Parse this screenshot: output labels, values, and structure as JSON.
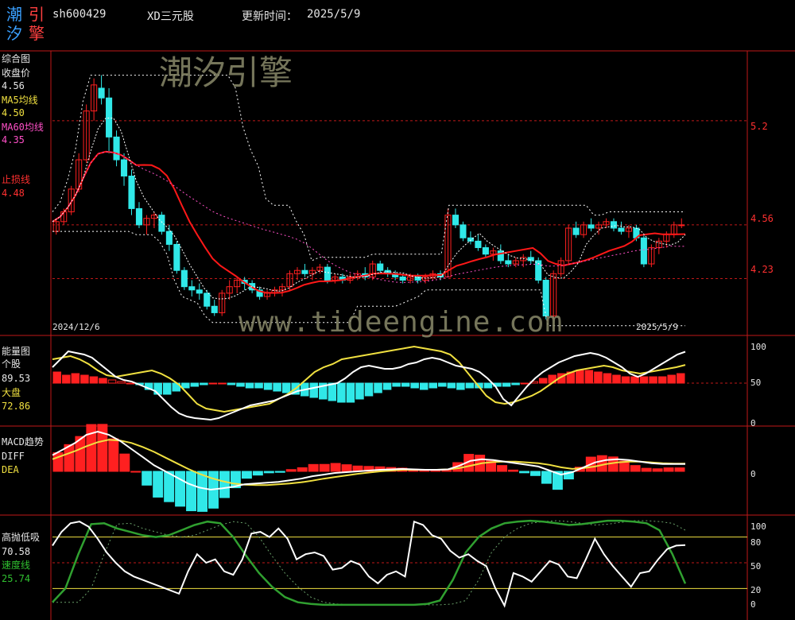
{
  "header": {
    "code": "sh600429",
    "name": "XD三元股",
    "update_label": "更新时间：",
    "update_date": "2025/5/9"
  },
  "logo": {
    "chars": [
      "潮",
      "引",
      "汐",
      "擎"
    ]
  },
  "watermarks": {
    "top": "潮汐引擎",
    "mid": "www.tideengine.com"
  },
  "colors": {
    "up": "#ff2020",
    "down": "#30e8e8",
    "ma5": "#f0e040",
    "ma60": "#ff50c8",
    "stop": "#ff3030",
    "speed": "#30a030"
  },
  "panels": {
    "main": {
      "title": "综合图",
      "close_label": "收盘价",
      "close_value": "4.56",
      "ma5_label": "MA5均线",
      "ma5_value": "4.50",
      "ma60_label": "MA60均线",
      "ma60_value": "4.35",
      "stop_label": "止损线",
      "stop_value": "4.48",
      "date_start": "2024/12/6",
      "date_end": "2025/5/9",
      "axis_labels": [
        "5.2",
        "4.56",
        "4.23"
      ]
    },
    "energy": {
      "title": "能量图",
      "stock_label": "个股",
      "stock_value": "89.53",
      "market_label": "大盘",
      "market_value": "72.86",
      "axis_labels": [
        "100",
        "50",
        "0"
      ]
    },
    "macd": {
      "title": "MACD趋势",
      "diff_label": "DIFF",
      "dea_label": "DEA",
      "axis_labels": [
        "0"
      ]
    },
    "gaopao": {
      "title": "高抛低吸",
      "value": "70.58",
      "speed_label": "速度线",
      "speed_value": "25.74",
      "axis_labels": [
        "100",
        "80",
        "50",
        "20",
        "0"
      ]
    }
  },
  "chart_data": {
    "type": "candlestick",
    "main_ylim": [
      3.9,
      5.6
    ],
    "candles": [
      [
        4.52,
        4.6,
        4.5,
        4.58
      ],
      [
        4.58,
        4.66,
        4.56,
        4.64
      ],
      [
        4.64,
        4.8,
        4.62,
        4.78
      ],
      [
        4.78,
        5.0,
        4.76,
        4.96
      ],
      [
        4.96,
        5.3,
        4.94,
        5.26
      ],
      [
        5.26,
        5.46,
        5.2,
        5.42
      ],
      [
        5.4,
        5.48,
        5.3,
        5.34
      ],
      [
        5.34,
        5.4,
        5.0,
        5.1
      ],
      [
        5.1,
        5.14,
        4.92,
        4.96
      ],
      [
        4.96,
        5.0,
        4.8,
        4.86
      ],
      [
        4.86,
        4.9,
        4.62,
        4.66
      ],
      [
        4.66,
        4.7,
        4.54,
        4.56
      ],
      [
        4.56,
        4.62,
        4.5,
        4.6
      ],
      [
        4.6,
        4.64,
        4.54,
        4.62
      ],
      [
        4.62,
        4.64,
        4.5,
        4.52
      ],
      [
        4.52,
        4.56,
        4.4,
        4.44
      ],
      [
        4.44,
        4.46,
        4.26,
        4.28
      ],
      [
        4.28,
        4.3,
        4.16,
        4.18
      ],
      [
        4.18,
        4.22,
        4.12,
        4.16
      ],
      [
        4.16,
        4.2,
        4.1,
        4.14
      ],
      [
        4.14,
        4.16,
        4.04,
        4.06
      ],
      [
        4.06,
        4.1,
        4.0,
        4.02
      ],
      [
        4.02,
        4.16,
        4.0,
        4.14
      ],
      [
        4.14,
        4.22,
        4.1,
        4.18
      ],
      [
        4.18,
        4.24,
        4.14,
        4.22
      ],
      [
        4.22,
        4.24,
        4.16,
        4.2
      ],
      [
        4.2,
        4.22,
        4.14,
        4.16
      ],
      [
        4.16,
        4.18,
        4.1,
        4.12
      ],
      [
        4.12,
        4.16,
        4.1,
        4.14
      ],
      [
        4.14,
        4.18,
        4.12,
        4.16
      ],
      [
        4.16,
        4.2,
        4.12,
        4.18
      ],
      [
        4.18,
        4.28,
        4.16,
        4.26
      ],
      [
        4.26,
        4.3,
        4.22,
        4.28
      ],
      [
        4.28,
        4.32,
        4.24,
        4.26
      ],
      [
        4.26,
        4.3,
        4.22,
        4.28
      ],
      [
        4.28,
        4.32,
        4.26,
        4.3
      ],
      [
        4.3,
        4.32,
        4.2,
        4.22
      ],
      [
        4.22,
        4.26,
        4.2,
        4.24
      ],
      [
        4.24,
        4.26,
        4.2,
        4.22
      ],
      [
        4.22,
        4.26,
        4.2,
        4.24
      ],
      [
        4.24,
        4.28,
        4.22,
        4.26
      ],
      [
        4.26,
        4.3,
        4.22,
        4.24
      ],
      [
        4.24,
        4.34,
        4.22,
        4.32
      ],
      [
        4.32,
        4.34,
        4.26,
        4.28
      ],
      [
        4.28,
        4.3,
        4.24,
        4.26
      ],
      [
        4.26,
        4.28,
        4.22,
        4.24
      ],
      [
        4.24,
        4.26,
        4.2,
        4.22
      ],
      [
        4.22,
        4.26,
        4.2,
        4.24
      ],
      [
        4.24,
        4.26,
        4.2,
        4.22
      ],
      [
        4.22,
        4.26,
        4.2,
        4.24
      ],
      [
        4.24,
        4.28,
        4.22,
        4.26
      ],
      [
        4.26,
        4.28,
        4.22,
        4.24
      ],
      [
        4.24,
        4.66,
        4.24,
        4.62
      ],
      [
        4.62,
        4.66,
        4.54,
        4.56
      ],
      [
        4.56,
        4.58,
        4.46,
        4.48
      ],
      [
        4.48,
        4.52,
        4.44,
        4.46
      ],
      [
        4.46,
        4.5,
        4.4,
        4.42
      ],
      [
        4.42,
        4.44,
        4.36,
        4.38
      ],
      [
        4.38,
        4.42,
        4.34,
        4.4
      ],
      [
        4.4,
        4.44,
        4.32,
        4.34
      ],
      [
        4.34,
        4.38,
        4.3,
        4.32
      ],
      [
        4.32,
        4.36,
        4.3,
        4.34
      ],
      [
        4.34,
        4.38,
        4.3,
        4.36
      ],
      [
        4.36,
        4.4,
        4.32,
        4.34
      ],
      [
        4.34,
        4.36,
        4.2,
        4.22
      ],
      [
        4.22,
        4.24,
        3.98,
        4.0
      ],
      [
        4.0,
        4.28,
        3.98,
        4.26
      ],
      [
        4.26,
        4.36,
        4.24,
        4.34
      ],
      [
        4.34,
        4.56,
        4.32,
        4.54
      ],
      [
        4.54,
        4.58,
        4.48,
        4.5
      ],
      [
        4.5,
        4.58,
        4.48,
        4.56
      ],
      [
        4.56,
        4.6,
        4.52,
        4.54
      ],
      [
        4.54,
        4.58,
        4.5,
        4.56
      ],
      [
        4.56,
        4.6,
        4.54,
        4.58
      ],
      [
        4.58,
        4.6,
        4.52,
        4.54
      ],
      [
        4.54,
        4.58,
        4.5,
        4.52
      ],
      [
        4.52,
        4.56,
        4.48,
        4.54
      ],
      [
        4.54,
        4.56,
        4.46,
        4.48
      ],
      [
        4.48,
        4.5,
        4.3,
        4.32
      ],
      [
        4.32,
        4.44,
        4.3,
        4.42
      ],
      [
        4.42,
        4.48,
        4.38,
        4.46
      ],
      [
        4.46,
        4.52,
        4.42,
        4.5
      ],
      [
        4.5,
        4.58,
        4.48,
        4.56
      ],
      [
        4.56,
        4.6,
        4.54,
        4.56
      ]
    ],
    "energy_ylim": [
      0,
      100
    ],
    "energy_stock": [
      70,
      80,
      90,
      88,
      86,
      82,
      74,
      66,
      58,
      54,
      52,
      48,
      44,
      40,
      30,
      20,
      12,
      8,
      6,
      5,
      4,
      6,
      10,
      14,
      18,
      22,
      24,
      26,
      28,
      32,
      36,
      40,
      42,
      44,
      46,
      48,
      50,
      56,
      64,
      70,
      72,
      70,
      68,
      68,
      70,
      74,
      76,
      80,
      82,
      80,
      76,
      72,
      70,
      68,
      64,
      56,
      46,
      30,
      22,
      34,
      46,
      56,
      64,
      70,
      76,
      80,
      84,
      86,
      88,
      86,
      82,
      76,
      70,
      62,
      58,
      62,
      68,
      74,
      80,
      86,
      89.53
    ],
    "energy_market": [
      80,
      82,
      84,
      80,
      74,
      66,
      60,
      58,
      60,
      62,
      64,
      66,
      62,
      56,
      48,
      36,
      24,
      18,
      16,
      14,
      16,
      18,
      20,
      22,
      24,
      30,
      36,
      44,
      54,
      64,
      70,
      74,
      80,
      82,
      84,
      86,
      88,
      90,
      92,
      94,
      96,
      94,
      92,
      90,
      86,
      76,
      62,
      48,
      34,
      26,
      24,
      26,
      30,
      34,
      40,
      48,
      56,
      62,
      66,
      68,
      70,
      72,
      70,
      66,
      64,
      62,
      64,
      66,
      68,
      70,
      72.86
    ],
    "energy_bars": [
      64,
      60,
      62,
      60,
      58,
      56,
      54,
      52,
      50,
      48,
      42,
      36,
      36,
      40,
      44,
      46,
      48,
      50,
      50,
      48,
      46,
      44,
      44,
      42,
      40,
      38,
      36,
      34,
      32,
      30,
      28,
      26,
      26,
      30,
      34,
      38,
      42,
      46,
      46,
      44,
      42,
      44,
      46,
      44,
      42,
      44,
      44,
      44,
      46,
      46,
      48,
      50,
      52,
      56,
      60,
      62,
      64,
      66,
      66,
      64,
      62,
      60,
      58,
      58,
      58,
      58,
      58,
      60,
      62
    ],
    "macd_ylim": [
      -1,
      1
    ],
    "macd_diff": [
      0.4,
      0.55,
      0.7,
      0.9,
      0.98,
      0.9,
      0.75,
      0.55,
      0.35,
      0.15,
      0.0,
      -0.15,
      -0.3,
      -0.4,
      -0.45,
      -0.42,
      -0.38,
      -0.32,
      -0.3,
      -0.28,
      -0.26,
      -0.22,
      -0.18,
      -0.12,
      -0.08,
      -0.04,
      -0.02,
      0.0,
      0.02,
      0.04,
      0.05,
      0.06,
      0.05,
      0.04,
      0.04,
      0.05,
      0.14,
      0.26,
      0.3,
      0.28,
      0.24,
      0.2,
      0.16,
      0.12,
      0.02,
      -0.08,
      -0.02,
      0.1,
      0.22,
      0.28,
      0.3,
      0.28,
      0.24,
      0.2,
      0.18,
      0.18,
      0.18
    ],
    "macd_dea": [
      0.3,
      0.4,
      0.5,
      0.62,
      0.72,
      0.78,
      0.76,
      0.7,
      0.6,
      0.48,
      0.34,
      0.2,
      0.06,
      -0.06,
      -0.16,
      -0.24,
      -0.3,
      -0.33,
      -0.34,
      -0.34,
      -0.32,
      -0.3,
      -0.27,
      -0.23,
      -0.18,
      -0.14,
      -0.1,
      -0.06,
      -0.03,
      0.0,
      0.02,
      0.04,
      0.04,
      0.04,
      0.04,
      0.05,
      0.08,
      0.14,
      0.2,
      0.23,
      0.24,
      0.24,
      0.22,
      0.2,
      0.16,
      0.1,
      0.06,
      0.08,
      0.12,
      0.18,
      0.22,
      0.24,
      0.24,
      0.22,
      0.2,
      0.19,
      0.19
    ],
    "gaopao_ylim": [
      0,
      100
    ],
    "gaopao_main": [
      70,
      86,
      96,
      98,
      92,
      78,
      62,
      50,
      40,
      34,
      30,
      26,
      22,
      18,
      14,
      40,
      60,
      50,
      54,
      40,
      36,
      54,
      84,
      86,
      80,
      90,
      78,
      54,
      60,
      62,
      58,
      42,
      44,
      52,
      48,
      34,
      26,
      36,
      40,
      34,
      98,
      94,
      82,
      78,
      64,
      56,
      60,
      52,
      46,
      20,
      0,
      38,
      34,
      28,
      40,
      52,
      48,
      34,
      32,
      54,
      78,
      60,
      46,
      34,
      22,
      38,
      40,
      54,
      66,
      70,
      70.58
    ],
    "gaopao_speed": [
      4,
      20,
      60,
      95,
      96,
      90,
      86,
      82,
      80,
      82,
      88,
      94,
      98,
      96,
      80,
      58,
      38,
      22,
      10,
      4,
      2,
      1,
      1,
      1,
      1,
      1,
      1,
      1,
      1,
      2,
      6,
      30,
      62,
      80,
      90,
      96,
      98,
      99,
      98,
      96,
      94,
      95,
      97,
      99,
      99,
      98,
      96,
      88,
      60,
      25.74
    ]
  }
}
